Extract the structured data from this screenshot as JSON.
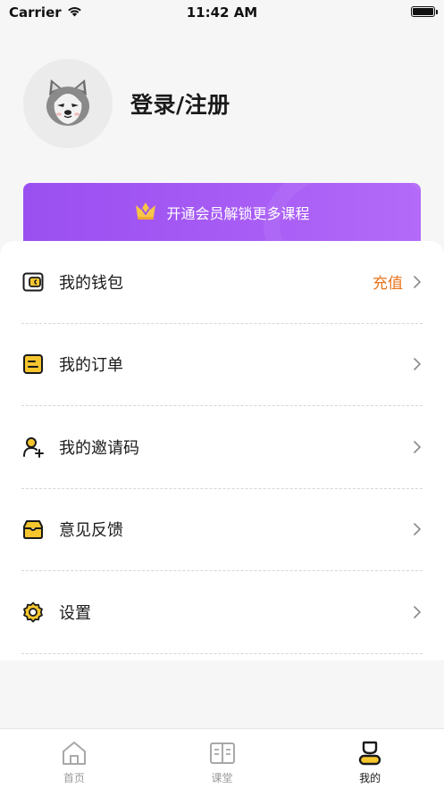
{
  "status_bar": {
    "carrier": "Carrier",
    "time": "11:42 AM",
    "wifi_icon": "wifi-icon",
    "battery_icon": "battery-icon"
  },
  "profile": {
    "avatar_icon": "husky-avatar",
    "login_label": "登录/注册"
  },
  "vip_banner": {
    "icon": "crown-icon",
    "label": "开通会员解锁更多课程",
    "colors": {
      "start": "#9a4ff0",
      "end": "#b36af8"
    }
  },
  "menu": {
    "items": [
      {
        "label": "我的钱包",
        "icon": "wallet-icon",
        "extra": "充值"
      },
      {
        "label": "我的订单",
        "icon": "order-icon"
      },
      {
        "label": "我的邀请码",
        "icon": "invite-user-icon"
      },
      {
        "label": "意见反馈",
        "icon": "feedback-icon"
      },
      {
        "label": "设置",
        "icon": "settings-gear-icon"
      }
    ],
    "accent_color": "#f5c62e",
    "extra_color": "#e8731a"
  },
  "tab_bar": {
    "tabs": [
      {
        "label": "首页",
        "icon": "home-icon",
        "active": false
      },
      {
        "label": "课堂",
        "icon": "book-icon",
        "active": false
      },
      {
        "label": "我的",
        "icon": "profile-icon",
        "active": true
      }
    ]
  }
}
